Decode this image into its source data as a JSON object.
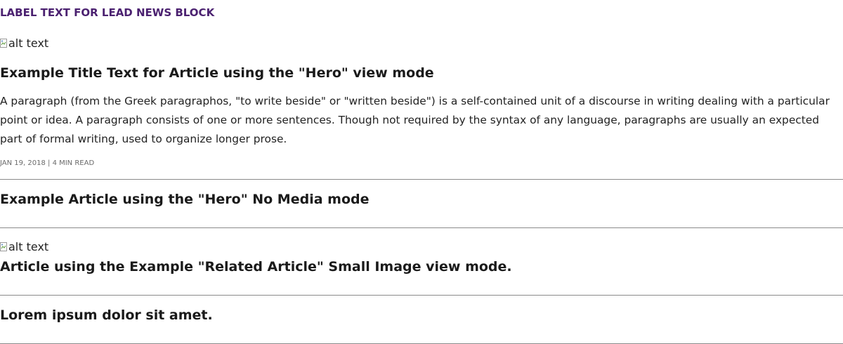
{
  "block_label": "LABEL TEXT FOR LEAD NEWS BLOCK",
  "hero": {
    "image_alt": "alt text",
    "title": "Example Title Text for Article using the \"Hero\" view mode",
    "paragraph": "A paragraph (from the Greek paragraphos, \"to write beside\" or \"written beside\") is a self-contained unit of a discourse in writing dealing with a particular point or idea. A paragraph consists of one or more sentences. Though not required by the syntax of any language, paragraphs are usually an expected part of formal writing, used to organize longer prose.",
    "date": "JAN 19, 2018",
    "separator": "|",
    "read_time": "4 MIN READ"
  },
  "hero_no_media": {
    "title": "Example Article using the \"Hero\" No Media mode"
  },
  "related_small_image": {
    "image_alt": "alt text",
    "title": "Article using the Example \"Related Article\" Small Image view mode."
  },
  "plain_article": {
    "title": "Lorem ipsum dolor sit amet."
  },
  "colors": {
    "label": "#4b2170",
    "text": "#1a1a1a",
    "meta": "#6b6b6b",
    "divider": "#8a8a8a"
  }
}
